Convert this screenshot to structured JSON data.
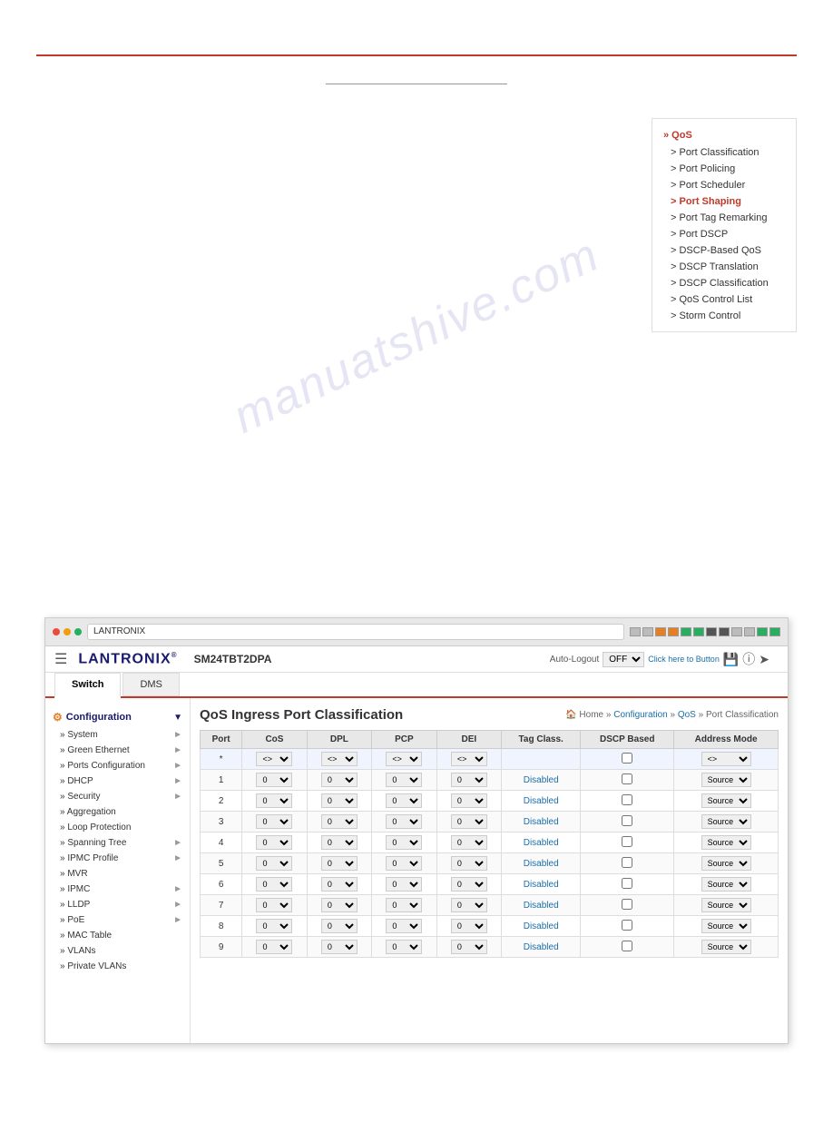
{
  "page": {
    "top_rule": true,
    "bottom_rule": true
  },
  "watermark": "manuatshive.com",
  "right_sidebar": {
    "header": "» QoS",
    "items": [
      {
        "label": "> Port Classification",
        "active": false
      },
      {
        "label": "> Port Policing",
        "active": false
      },
      {
        "label": "> Port Scheduler",
        "active": false
      },
      {
        "label": "> Port Shaping",
        "active": true
      },
      {
        "label": "> Port Tag Remarking",
        "active": false
      },
      {
        "label": "> Port DSCP",
        "active": false
      },
      {
        "label": "> DSCP-Based QoS",
        "active": false
      },
      {
        "label": "> DSCP Translation",
        "active": false
      },
      {
        "label": "> DSCP Classification",
        "active": false
      },
      {
        "label": "> QoS Control List",
        "active": false
      },
      {
        "label": "> Storm Control",
        "active": false
      }
    ]
  },
  "browser": {
    "address": "LANTRONIX"
  },
  "app_header": {
    "logo": "LANTRONIX",
    "device_name": "SM24TBT2DPA",
    "autologout_label": "Auto-Logout",
    "autologout_value": "OFF",
    "autologout_link": "Click here to Button"
  },
  "tabs": [
    {
      "label": "Switch",
      "active": true
    },
    {
      "label": "DMS",
      "active": false
    }
  ],
  "left_sidebar": {
    "config_header": "Configuration",
    "items": [
      {
        "label": "System",
        "has_arrow": true
      },
      {
        "label": "Green Ethernet",
        "has_arrow": true
      },
      {
        "label": "Ports Configuration",
        "has_arrow": true
      },
      {
        "label": "DHCP",
        "has_arrow": true
      },
      {
        "label": "Security",
        "has_arrow": true
      },
      {
        "label": "Aggregation",
        "has_arrow": false
      },
      {
        "label": "Loop Protection",
        "has_arrow": false
      },
      {
        "label": "Spanning Tree",
        "has_arrow": true
      },
      {
        "label": "IPMC Profile",
        "has_arrow": true
      },
      {
        "label": "MVR",
        "has_arrow": false
      },
      {
        "label": "IPMC",
        "has_arrow": true
      },
      {
        "label": "LLDP",
        "has_arrow": true
      },
      {
        "label": "PoE",
        "has_arrow": true
      },
      {
        "label": "MAC Table",
        "has_arrow": false
      },
      {
        "label": "VLANs",
        "has_arrow": false
      },
      {
        "label": "Private VLANs",
        "has_arrow": false
      }
    ]
  },
  "main": {
    "page_title": "QoS Ingress Port Classification",
    "breadcrumb": {
      "home": "Home",
      "separator1": " » ",
      "config": "Configuration",
      "separator2": " » ",
      "qos": "QoS",
      "separator3": " » ",
      "current": "Port Classification"
    },
    "table": {
      "headers": [
        "Port",
        "CoS",
        "DPL",
        "PCP",
        "DEI",
        "Tag Class.",
        "DSCP Based",
        "Address Mode"
      ],
      "star_row": {
        "port": "*",
        "cos": "<>",
        "dpl": "<>",
        "pcp": "<>",
        "dei": "<>",
        "tag_class": "",
        "dscp_based": false,
        "address_mode": "<>"
      },
      "rows": [
        {
          "port": "1",
          "cos": "0",
          "dpl": "0",
          "pcp": "0",
          "dei": "0",
          "tag_class": "Disabled",
          "dscp_based": false,
          "address_mode": "Source"
        },
        {
          "port": "2",
          "cos": "0",
          "dpl": "0",
          "pcp": "0",
          "dei": "0",
          "tag_class": "Disabled",
          "dscp_based": false,
          "address_mode": "Source"
        },
        {
          "port": "3",
          "cos": "0",
          "dpl": "0",
          "pcp": "0",
          "dei": "0",
          "tag_class": "Disabled",
          "dscp_based": false,
          "address_mode": "Source"
        },
        {
          "port": "4",
          "cos": "0",
          "dpl": "0",
          "pcp": "0",
          "dei": "0",
          "tag_class": "Disabled",
          "dscp_based": false,
          "address_mode": "Source"
        },
        {
          "port": "5",
          "cos": "0",
          "dpl": "0",
          "pcp": "0",
          "dei": "0",
          "tag_class": "Disabled",
          "dscp_based": false,
          "address_mode": "Source"
        },
        {
          "port": "6",
          "cos": "0",
          "dpl": "0",
          "pcp": "0",
          "dei": "0",
          "tag_class": "Disabled",
          "dscp_based": false,
          "address_mode": "Source"
        },
        {
          "port": "7",
          "cos": "0",
          "dpl": "0",
          "pcp": "0",
          "dei": "0",
          "tag_class": "Disabled",
          "dscp_based": false,
          "address_mode": "Source"
        },
        {
          "port": "8",
          "cos": "0",
          "dpl": "0",
          "pcp": "0",
          "dei": "0",
          "tag_class": "Disabled",
          "dscp_based": false,
          "address_mode": "Source"
        },
        {
          "port": "9",
          "cos": "0",
          "dpl": "0",
          "pcp": "0",
          "dei": "0",
          "tag_class": "Disabled",
          "dscp_based": false,
          "address_mode": "Source"
        }
      ]
    }
  },
  "bottom_center": {
    "line": "___________________"
  },
  "colors": {
    "accent_red": "#c0392b",
    "link_blue": "#1a6ea8",
    "sidebar_blue": "#1a1a6e"
  }
}
